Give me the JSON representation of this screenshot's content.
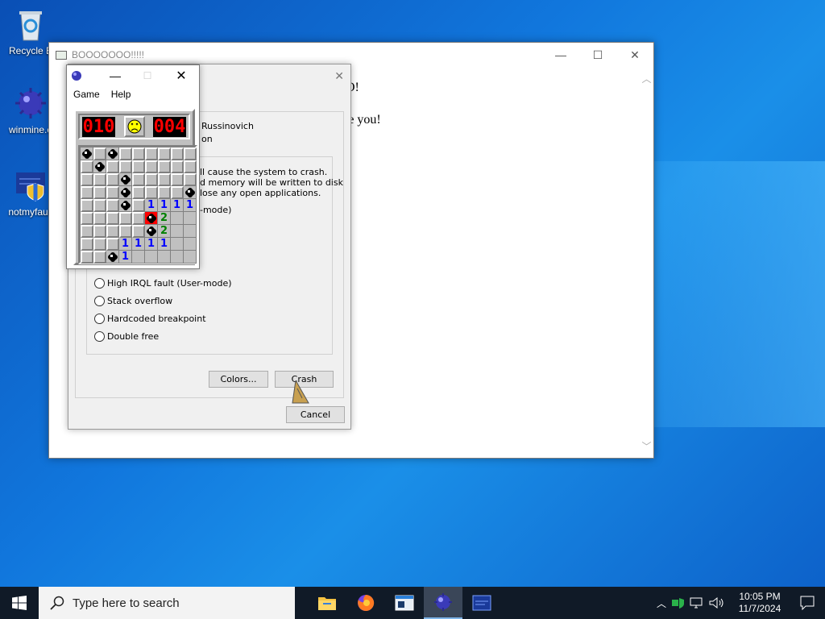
{
  "desktop": {
    "icons": [
      {
        "label": "Recycle B",
        "icon": "recycle-bin-icon"
      },
      {
        "label": "winmine.e",
        "icon": "minesweeper-icon"
      },
      {
        "label": "notmyfault",
        "icon": "shield-app-icon"
      }
    ]
  },
  "boo_window": {
    "title": "BOOOOOOO!!!!!",
    "line1_tail": "O!",
    "line2_tail": "re you!"
  },
  "crash_dialog": {
    "author_tail": "Russinovich",
    "subtitle_tail": "on",
    "desc_line1": "ll cause the system to crash.",
    "desc_line2": "d memory will be written to disk",
    "desc_line3": "lose any open applications.",
    "mode_tail": "-mode)",
    "options": [
      "High IRQL fault (User-mode)",
      "Stack overflow",
      "Hardcoded breakpoint",
      "Double free"
    ],
    "colors_button": "Colors...",
    "crash_button": "Crash",
    "cancel_button": "Cancel"
  },
  "minesweeper": {
    "menu": [
      "Game",
      "Help"
    ],
    "mines_counter": "010",
    "timer": "004",
    "face": "dead",
    "grid": [
      [
        "m",
        "u",
        "m",
        "u",
        "u",
        "u",
        "u",
        "u",
        "u"
      ],
      [
        "u",
        "m",
        "u",
        "u",
        "u",
        "u",
        "u",
        "u",
        "u"
      ],
      [
        "u",
        "u",
        "u",
        "m",
        "u",
        "u",
        "u",
        "u",
        "u"
      ],
      [
        "u",
        "u",
        "u",
        "m",
        "u",
        "u",
        "u",
        "u",
        "m"
      ],
      [
        "u",
        "u",
        "u",
        "m",
        "u",
        "1",
        "1",
        "1",
        "1"
      ],
      [
        "u",
        "u",
        "u",
        "u",
        "u",
        "x",
        "2",
        "o",
        "o"
      ],
      [
        "u",
        "u",
        "u",
        "u",
        "u",
        "m",
        "2",
        "o",
        "o"
      ],
      [
        "u",
        "u",
        "u",
        "1",
        "1",
        "1",
        "1",
        "o",
        "o"
      ],
      [
        "u",
        "u",
        "m",
        "1",
        "o",
        "o",
        "o",
        "o",
        "o"
      ]
    ]
  },
  "taskbar": {
    "search_placeholder": "Type here to search",
    "time": "10:05 PM",
    "date": "11/7/2024"
  }
}
